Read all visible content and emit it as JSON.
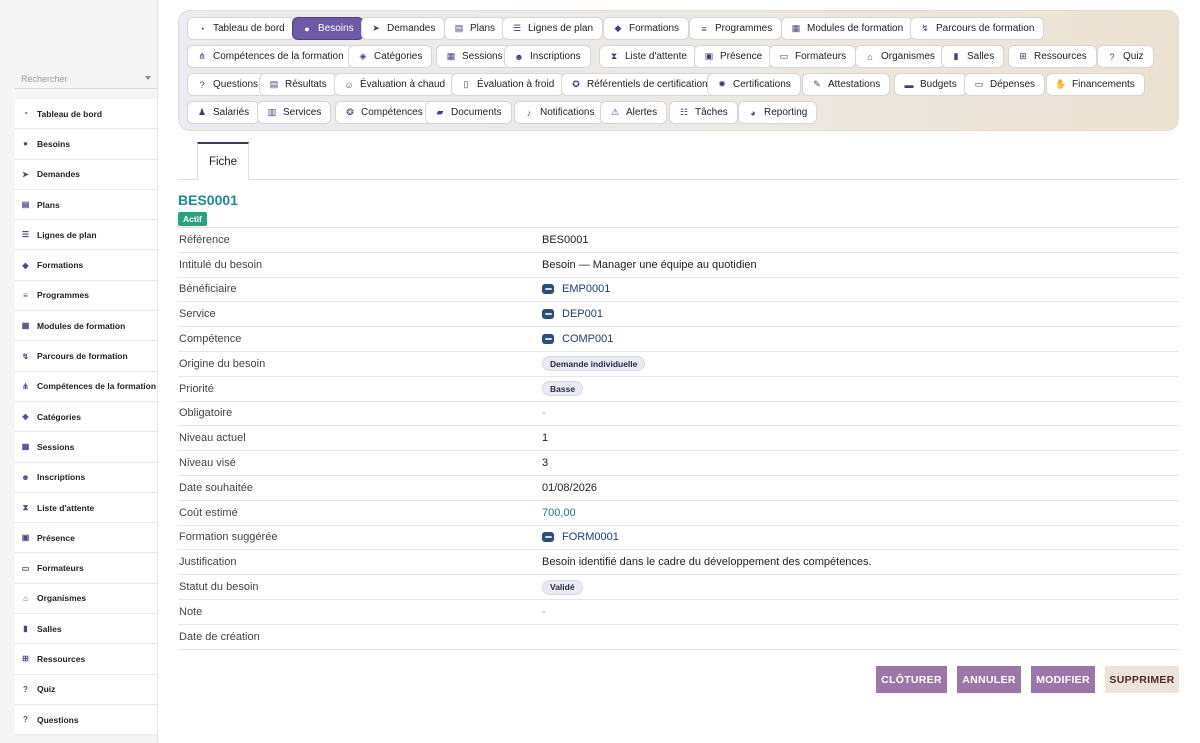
{
  "search": {
    "placeholder": "Rechercher"
  },
  "sidebar": {
    "items": [
      {
        "label": "Tableau de bord",
        "icon": "gauge-icon"
      },
      {
        "label": "Besoins",
        "icon": "lightbulb-icon"
      },
      {
        "label": "Demandes",
        "icon": "paper-plane-icon"
      },
      {
        "label": "Plans",
        "icon": "clipboard-icon"
      },
      {
        "label": "Lignes de plan",
        "icon": "list-icon"
      },
      {
        "label": "Formations",
        "icon": "graduation-cap-icon"
      },
      {
        "label": "Programmes",
        "icon": "bars-icon"
      },
      {
        "label": "Modules de formation",
        "icon": "cubes-icon"
      },
      {
        "label": "Parcours de formation",
        "icon": "route-icon"
      },
      {
        "label": "Compétences de la formation",
        "icon": "diagram-icon"
      },
      {
        "label": "Catégories",
        "icon": "tags-icon"
      },
      {
        "label": "Sessions",
        "icon": "calendar-icon"
      },
      {
        "label": "Inscriptions",
        "icon": "user-plus-icon"
      },
      {
        "label": "Liste d'attente",
        "icon": "hourglass-icon"
      },
      {
        "label": "Présence",
        "icon": "clipboard-check-icon"
      },
      {
        "label": "Formateurs",
        "icon": "chalkboard-icon"
      },
      {
        "label": "Organismes",
        "icon": "building-columns-icon"
      },
      {
        "label": "Salles",
        "icon": "door-icon"
      },
      {
        "label": "Ressources",
        "icon": "sitemap-icon"
      },
      {
        "label": "Quiz",
        "icon": "question-circle-icon"
      },
      {
        "label": "Questions",
        "icon": "question-icon"
      }
    ]
  },
  "topmenu": {
    "active": "Besoins",
    "rows": [
      [
        {
          "label": "Tableau de bord",
          "icon": "gauge-icon",
          "glyph": "◔"
        },
        {
          "label": "Besoins",
          "icon": "lightbulb-icon",
          "glyph": "●"
        },
        {
          "label": "Demandes",
          "icon": "paper-plane-icon",
          "glyph": "➤"
        },
        {
          "label": "Plans",
          "icon": "clipboard-icon",
          "glyph": "▤"
        },
        {
          "label": "Lignes de plan",
          "icon": "list-icon",
          "glyph": "☰"
        },
        {
          "label": "Formations",
          "icon": "graduation-cap-icon",
          "glyph": "◆"
        },
        {
          "label": "Programmes",
          "icon": "bars-icon",
          "glyph": "≡"
        },
        {
          "label": "Modules de formation",
          "icon": "cubes-icon",
          "glyph": "▦"
        },
        {
          "label": "Parcours de formation",
          "icon": "route-icon",
          "glyph": "↯"
        }
      ],
      [
        {
          "label": "Compétences de la formation",
          "icon": "diagram-icon",
          "glyph": "⋔"
        },
        {
          "label": "Catégories",
          "icon": "tags-icon",
          "glyph": "◈"
        },
        {
          "label": "Sessions",
          "icon": "calendar-icon",
          "glyph": "▦"
        },
        {
          "label": "Inscriptions",
          "icon": "user-plus-icon",
          "glyph": "☻"
        },
        {
          "label": "Liste d'attente",
          "icon": "hourglass-icon",
          "glyph": "⧗"
        },
        {
          "label": "Présence",
          "icon": "clipboard-check-icon",
          "glyph": "▣"
        },
        {
          "label": "Formateurs",
          "icon": "chalkboard-icon",
          "glyph": "▭"
        },
        {
          "label": "Organismes",
          "icon": "building-columns-icon",
          "glyph": "⌂"
        },
        {
          "label": "Salles",
          "icon": "door-icon",
          "glyph": "▮"
        },
        {
          "label": "Ressources",
          "icon": "sitemap-icon",
          "glyph": "⊞"
        },
        {
          "label": "Quiz",
          "icon": "question-circle-icon",
          "glyph": "?"
        }
      ],
      [
        {
          "label": "Questions",
          "icon": "question-icon",
          "glyph": "?"
        },
        {
          "label": "Résultats",
          "icon": "square-poll-icon",
          "glyph": "▤"
        },
        {
          "label": "Évaluation à chaud",
          "icon": "smile-icon",
          "glyph": "☺"
        },
        {
          "label": "Évaluation à froid",
          "icon": "thermometer-icon",
          "glyph": "▯"
        },
        {
          "label": "Référentiels de certification",
          "icon": "award-icon",
          "glyph": "✪"
        },
        {
          "label": "Certifications",
          "icon": "certificate-icon",
          "glyph": "✹"
        },
        {
          "label": "Attestations",
          "icon": "file-signature-icon",
          "glyph": "✎"
        },
        {
          "label": "Budgets",
          "icon": "wallet-icon",
          "glyph": "▬"
        },
        {
          "label": "Dépenses",
          "icon": "money-bill-icon",
          "glyph": "▭"
        },
        {
          "label": "Financements",
          "icon": "hand-holding-icon",
          "glyph": "✋"
        }
      ],
      [
        {
          "label": "Salariés",
          "icon": "user-icon",
          "glyph": "♟"
        },
        {
          "label": "Services",
          "icon": "building-icon",
          "glyph": "▥"
        },
        {
          "label": "Compétences",
          "icon": "brain-icon",
          "glyph": "❂"
        },
        {
          "label": "Documents",
          "icon": "folder-icon",
          "glyph": "▰"
        },
        {
          "label": "Notifications",
          "icon": "bell-icon",
          "glyph": "♪"
        },
        {
          "label": "Alertes",
          "icon": "warning-icon",
          "glyph": "⚠"
        },
        {
          "label": "Tâches",
          "icon": "tasks-icon",
          "glyph": "☷"
        },
        {
          "label": "Reporting",
          "icon": "chart-pie-icon",
          "glyph": "◕"
        }
      ]
    ]
  },
  "subtabs": {
    "fiche": "Fiche"
  },
  "record": {
    "title": "BES0001",
    "status_badge": "Actif",
    "fields": [
      {
        "label": "Référence",
        "value": "BES0001",
        "kind": "text"
      },
      {
        "label": "Intitulé du besoin",
        "value": "Besoin — Manager une équipe au quotidien",
        "kind": "text"
      },
      {
        "label": "Bénéficiaire",
        "value": "EMP0001",
        "kind": "ref"
      },
      {
        "label": "Service",
        "value": "DEP001",
        "kind": "ref"
      },
      {
        "label": "Compétence",
        "value": "COMP001",
        "kind": "ref"
      },
      {
        "label": "Origine du besoin",
        "value": "Demande individuelle",
        "kind": "pill"
      },
      {
        "label": "Priorité",
        "value": "Basse",
        "kind": "pill"
      },
      {
        "label": "Obligatoire",
        "value": "-",
        "kind": "dash"
      },
      {
        "label": "Niveau actuel",
        "value": "1",
        "kind": "text"
      },
      {
        "label": "Niveau visé",
        "value": "3",
        "kind": "text"
      },
      {
        "label": "Date souhaitée",
        "value": "01/08/2026",
        "kind": "text"
      },
      {
        "label": "Coût estimé",
        "value": "700,00",
        "kind": "money"
      },
      {
        "label": "Formation suggérée",
        "value": "FORM0001",
        "kind": "ref"
      },
      {
        "label": "Justification",
        "value": "Besoin identifié dans le cadre du développement des compétences.",
        "kind": "text"
      },
      {
        "label": "Statut du besoin",
        "value": "Validé",
        "kind": "pill"
      },
      {
        "label": "Note",
        "value": "-",
        "kind": "dash"
      },
      {
        "label": "Date de création",
        "value": "",
        "kind": "text"
      }
    ]
  },
  "actions": {
    "cloturer": "CLÔTURER",
    "annuler": "ANNULER",
    "modifier": "MODIFIER",
    "supprimer": "SUPPRIMER"
  },
  "colors": {
    "accent": "#6e5ba8",
    "title": "#1d8a8e",
    "badge": "#27a47e",
    "button": "#9b76a8"
  }
}
